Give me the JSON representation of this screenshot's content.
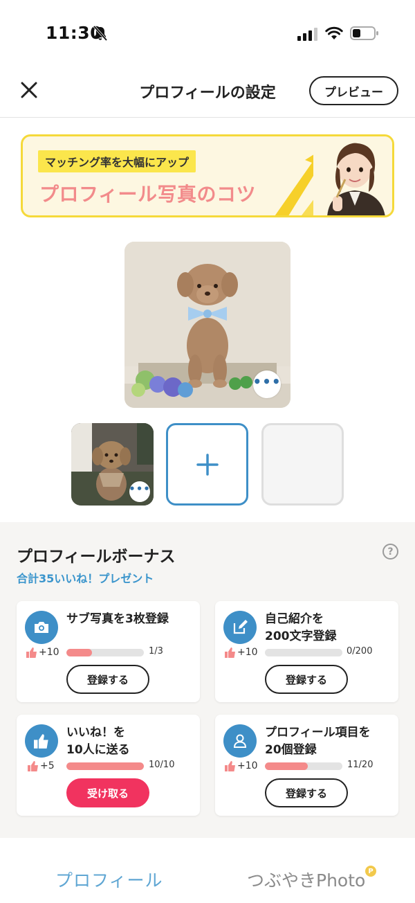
{
  "status_bar": {
    "time": "11:30"
  },
  "header": {
    "title": "プロフィールの設定",
    "preview_label": "プレビュー"
  },
  "banner": {
    "tag": "マッチング率を大幅にアップ",
    "headline": "プロフィール写真のコツ"
  },
  "photos": {
    "main_more": "•••",
    "sub_more": "•••",
    "add_symbol": "+"
  },
  "bonus": {
    "title": "プロフィールボーナス",
    "subtitle": "合計35いいね！プレゼント",
    "help": "?",
    "cards": [
      {
        "title": "サブ写真を3枚登録",
        "points": "+10",
        "count": "1/3",
        "progress": 0.33,
        "button": "登録する",
        "icon": "camera-icon"
      },
      {
        "title": "自己紹介を\n200文字登録",
        "points": "+10",
        "count": "0/200",
        "progress": 0,
        "button": "登録する",
        "icon": "edit-icon"
      },
      {
        "title": "いいね！を\n10人に送る",
        "points": "+5",
        "count": "10/10",
        "progress": 1.0,
        "button": "受け取る",
        "icon": "thumbs-up-icon"
      },
      {
        "title": "プロフィール項目を\n20個登録",
        "points": "+10",
        "count": "11/20",
        "progress": 0.55,
        "button": "登録する",
        "icon": "person-icon"
      }
    ]
  },
  "tabs": {
    "profile": "プロフィール",
    "photo": "つぶやきPhoto",
    "badge": "P"
  },
  "colors": {
    "accent_blue": "#3e8fc7",
    "progress_pink": "#f48a8a",
    "receive_red": "#f1335f",
    "banner_yellow": "#f5d93a"
  }
}
